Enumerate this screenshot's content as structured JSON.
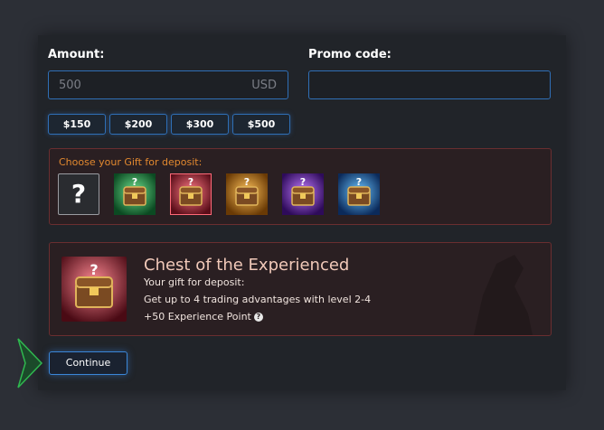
{
  "amount": {
    "label": "Amount:",
    "value": "500",
    "currency": "USD"
  },
  "promo": {
    "label": "Promo code:",
    "value": ""
  },
  "presets": [
    "$150",
    "$200",
    "$300",
    "$500"
  ],
  "gift": {
    "title": "Choose your Gift for deposit:",
    "options": [
      {
        "name": "no-gift",
        "symbol": "?"
      },
      {
        "name": "green-chest",
        "color": "#1f9a4a"
      },
      {
        "name": "red-chest",
        "color": "#c1283a",
        "selected": true
      },
      {
        "name": "orange-chest",
        "color": "#d07a14"
      },
      {
        "name": "purple-chest",
        "color": "#7a2fc8"
      },
      {
        "name": "blue-chest",
        "color": "#1f7fd8"
      }
    ]
  },
  "selected_gift": {
    "title": "Chest of the Experienced",
    "subtitle": "Your gift for deposit:",
    "line1": "Get up to 4 trading advantages with level 2-4",
    "line2": "+50 Experience Point"
  },
  "continue_label": "Continue",
  "colors": {
    "accent_blue": "#2f6fb6",
    "gift_orange": "#e3892f",
    "panel_red_border": "#6a2e30"
  }
}
